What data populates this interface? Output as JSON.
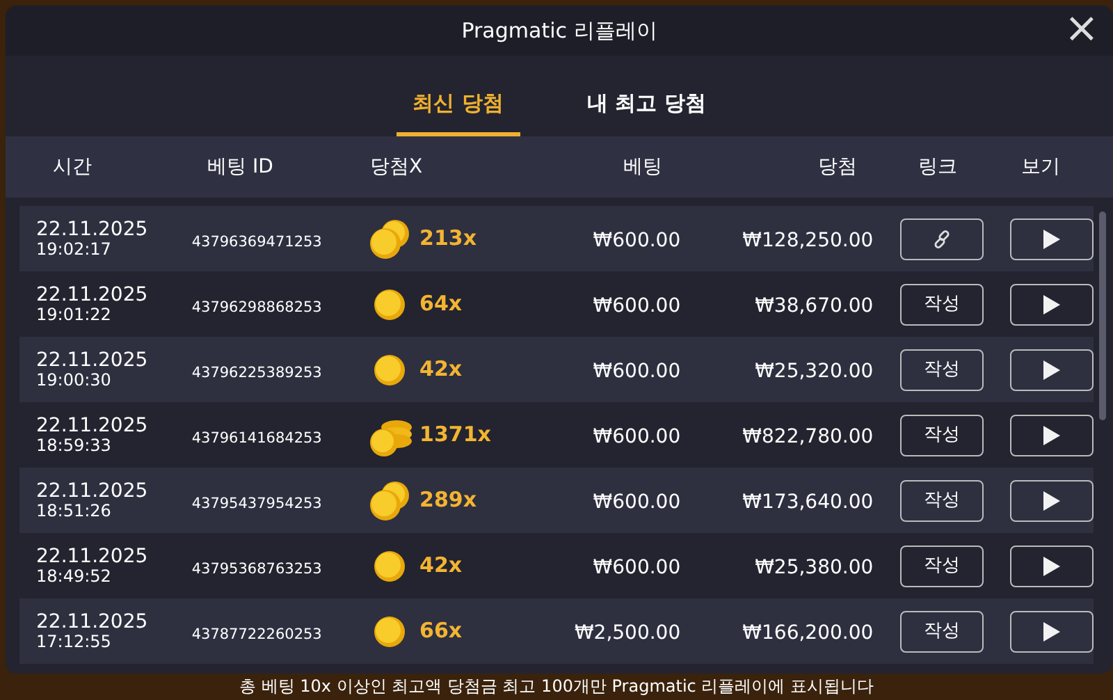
{
  "window": {
    "title": "Pragmatic 리플레이",
    "close": "×"
  },
  "tabs": [
    {
      "label": "최신 당첨",
      "selected": true
    },
    {
      "label": "내 최고 당첨",
      "selected": false
    }
  ],
  "table": {
    "columns": [
      "시간",
      "베팅 ID",
      "당첨X",
      "베팅",
      "당첨",
      "링크",
      "보기"
    ],
    "rows": [
      {
        "date": "22.11.2025",
        "time": "19:02:17",
        "bet_id": "43796369471253",
        "coins": {
          "kind": "double"
        },
        "multiplier": "213x",
        "bet": "₩600.00",
        "win": "₩128,250.00",
        "link": {
          "kind": "icon"
        }
      },
      {
        "date": "22.11.2025",
        "time": "19:01:22",
        "bet_id": "43796298868253",
        "coins": {
          "kind": "single"
        },
        "multiplier": "64x",
        "bet": "₩600.00",
        "win": "₩38,670.00",
        "link": {
          "kind": "text",
          "label": "작성"
        }
      },
      {
        "date": "22.11.2025",
        "time": "19:00:30",
        "bet_id": "43796225389253",
        "coins": {
          "kind": "single"
        },
        "multiplier": "42x",
        "bet": "₩600.00",
        "win": "₩25,320.00",
        "link": {
          "kind": "text",
          "label": "작성"
        }
      },
      {
        "date": "22.11.2025",
        "time": "18:59:33",
        "bet_id": "43796141684253",
        "coins": {
          "kind": "stack"
        },
        "multiplier": "1371x",
        "bet": "₩600.00",
        "win": "₩822,780.00",
        "link": {
          "kind": "text",
          "label": "작성"
        }
      },
      {
        "date": "22.11.2025",
        "time": "18:51:26",
        "bet_id": "43795437954253",
        "coins": {
          "kind": "double"
        },
        "multiplier": "289x",
        "bet": "₩600.00",
        "win": "₩173,640.00",
        "link": {
          "kind": "text",
          "label": "작성"
        }
      },
      {
        "date": "22.11.2025",
        "time": "18:49:52",
        "bet_id": "43795368763253",
        "coins": {
          "kind": "single"
        },
        "multiplier": "42x",
        "bet": "₩600.00",
        "win": "₩25,380.00",
        "link": {
          "kind": "text",
          "label": "작성"
        }
      },
      {
        "date": "22.11.2025",
        "time": "17:12:55",
        "bet_id": "43787722260253",
        "coins": {
          "kind": "single"
        },
        "multiplier": "66x",
        "bet": "₩2,500.00",
        "win": "₩166,200.00",
        "link": {
          "kind": "text",
          "label": "작성"
        }
      }
    ]
  },
  "footer": "총 베팅 10x 이상인 최고액 당첨금 최고 100개만 Pragmatic 리플레이에 표시됩니다"
}
